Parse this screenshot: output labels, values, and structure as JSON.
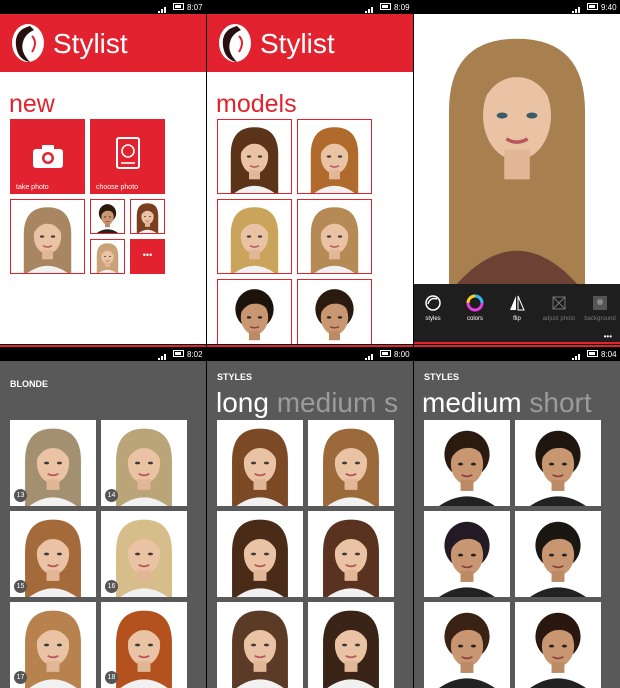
{
  "panel1": {
    "time": "8:07",
    "app_title": "Stylist",
    "section": "new",
    "take_photo": "take photo",
    "choose_photo": "choose photo",
    "more": "•••"
  },
  "panel2": {
    "time": "8:09",
    "app_title": "Stylist",
    "section": "models"
  },
  "panel3": {
    "time": "9:40",
    "toolbar": {
      "styles": "styles",
      "colors": "colors",
      "flip": "flip",
      "adjust_photo": "adjust photo",
      "background": "background"
    },
    "more": "•••"
  },
  "panel4": {
    "time": "8:02",
    "header": "BLONDE",
    "numbers": [
      "13",
      "14",
      "15",
      "16",
      "17",
      "18"
    ]
  },
  "panel5": {
    "time": "8:00",
    "header": "STYLES",
    "active": "long",
    "next": "medium",
    "peek": "s"
  },
  "panel6": {
    "time": "8:04",
    "header": "STYLES",
    "active": "medium",
    "next": "short"
  },
  "colors": {
    "accent": "#e2232f",
    "dark_bg": "#595959",
    "toolbar": "#1e1e1e"
  }
}
